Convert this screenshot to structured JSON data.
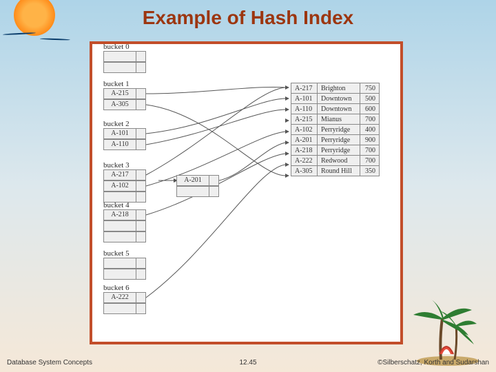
{
  "title": "Example of Hash Index",
  "footer": {
    "left": "Database System Concepts",
    "mid": "12.45",
    "right": "©Silberschatz, Korth and Sudarshan"
  },
  "buckets": {
    "b0": "bucket 0",
    "b1": "bucket 1",
    "b2": "bucket 2",
    "b3": "bucket 3",
    "b4": "bucket 4",
    "b5": "bucket 5",
    "b6": "bucket 6"
  },
  "entries": {
    "b1a": "A-215",
    "b1b": "A-305",
    "b2a": "A-101",
    "b2b": "A-110",
    "b3a": "A-217",
    "b3b": "A-102",
    "b4a": "A-218",
    "b6a": "A-222",
    "ovf": "A-201"
  },
  "records": [
    {
      "id": "A-217",
      "branch": "Brighton",
      "bal": "750"
    },
    {
      "id": "A-101",
      "branch": "Downtown",
      "bal": "500"
    },
    {
      "id": "A-110",
      "branch": "Downtown",
      "bal": "600"
    },
    {
      "id": "A-215",
      "branch": "Mianus",
      "bal": "700"
    },
    {
      "id": "A-102",
      "branch": "Perryridge",
      "bal": "400"
    },
    {
      "id": "A-201",
      "branch": "Perryridge",
      "bal": "900"
    },
    {
      "id": "A-218",
      "branch": "Perryridge",
      "bal": "700"
    },
    {
      "id": "A-222",
      "branch": "Redwood",
      "bal": "700"
    },
    {
      "id": "A-305",
      "branch": "Round Hill",
      "bal": "350"
    }
  ]
}
